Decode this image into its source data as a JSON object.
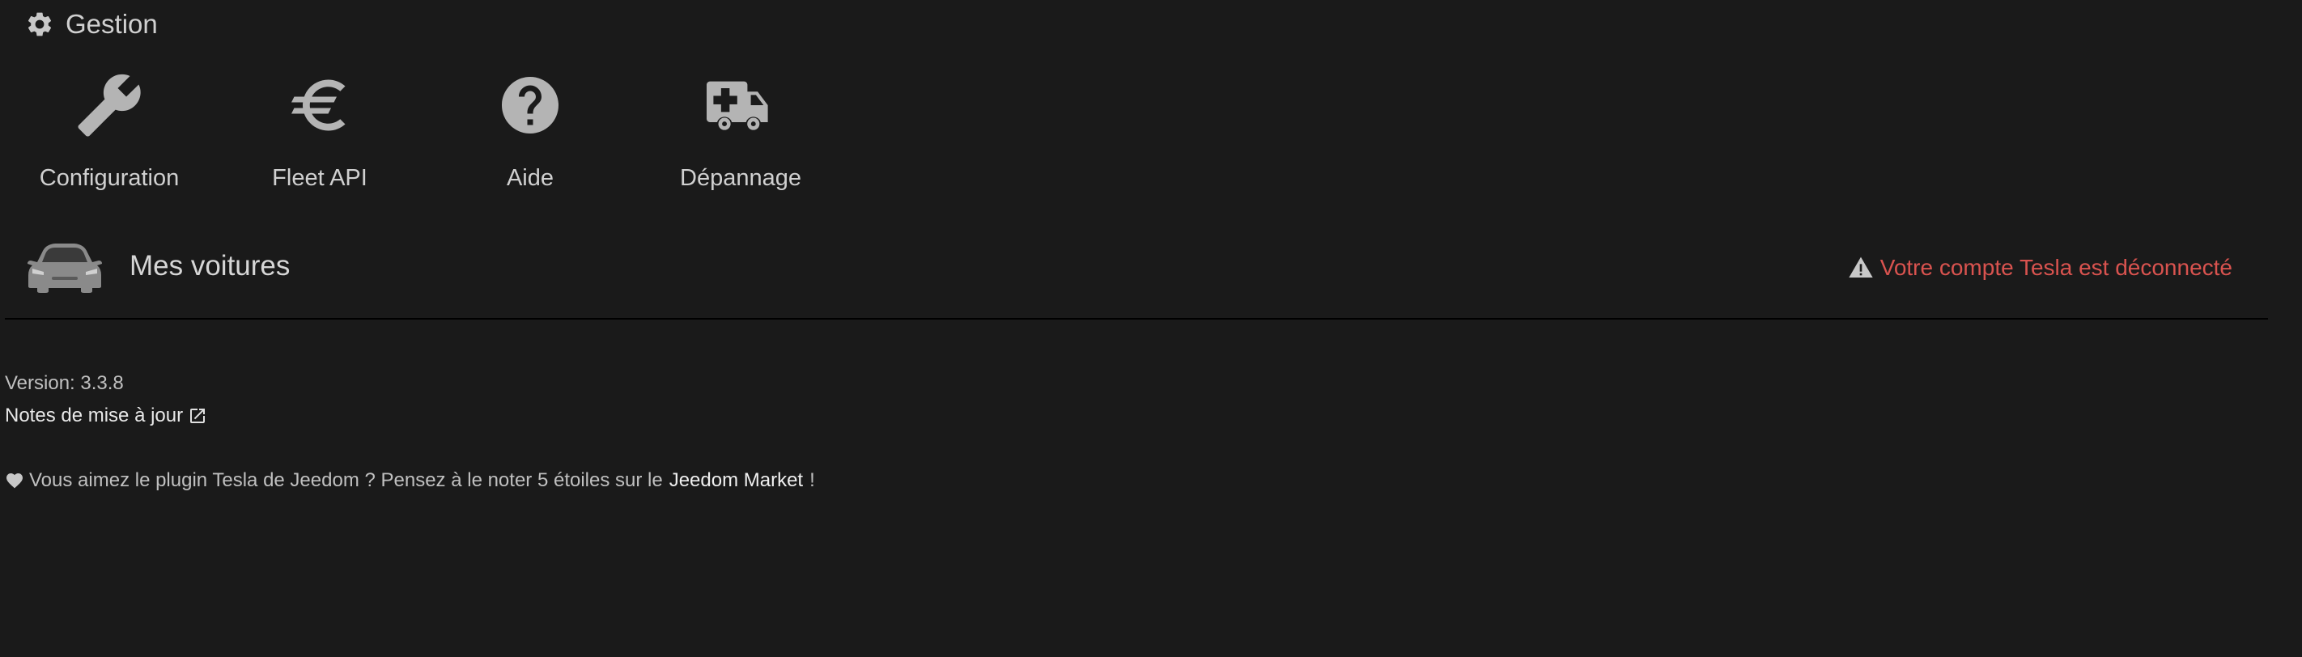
{
  "management": {
    "title": "Gestion",
    "icon": "gear-icon"
  },
  "tiles": [
    {
      "label": "Configuration",
      "icon": "wrench-icon"
    },
    {
      "label": "Fleet API",
      "icon": "euro-icon"
    },
    {
      "label": "Aide",
      "icon": "question-circle-icon"
    },
    {
      "label": "Dépannage",
      "icon": "ambulance-icon"
    }
  ],
  "cars": {
    "title": "Mes voitures",
    "icon": "car-icon"
  },
  "warning": {
    "text": "Votre compte Tesla est déconnecté",
    "icon": "warning-icon",
    "color": "#d9534f"
  },
  "footer": {
    "version": "Version: 3.3.8",
    "notes_link": "Notes de mise à jour",
    "rating_prefix": "Vous aimez le plugin Tesla de Jeedom ? Pensez à le noter 5 étoiles sur le",
    "market_link": "Jeedom Market",
    "rating_suffix": "!"
  },
  "colors": {
    "background": "#1a1a1a",
    "text": "#c8c8c8",
    "icon": "#b4b4b4"
  }
}
